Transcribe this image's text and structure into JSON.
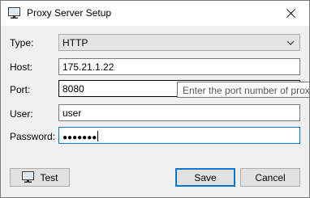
{
  "window": {
    "title": "Proxy Server Setup",
    "icon": "monitor-icon",
    "close_glyph": "✕"
  },
  "form": {
    "type_label": "Type:",
    "type_value": "HTTP",
    "host_label": "Host:",
    "host_value": "175.21.1.22",
    "port_label": "Port:",
    "port_value": "8080",
    "user_label": "User:",
    "user_value": "user",
    "password_label": "Password:",
    "password_value": "●●●●●●●"
  },
  "tooltip": {
    "text": "Enter the port number of prox"
  },
  "buttons": {
    "test_label": "Test",
    "save_label": "Save",
    "cancel_label": "Cancel"
  },
  "colors": {
    "focus_accent": "#0078d7",
    "dialog_background": "#f0f0f0"
  }
}
